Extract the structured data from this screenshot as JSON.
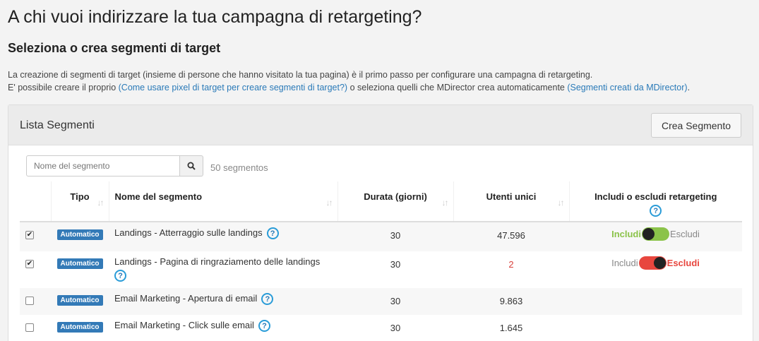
{
  "header": {
    "title": "A chi vuoi indirizzare la tua campagna di retargeting?",
    "subtitle": "Seleziona o crea segmenti di target",
    "desc_line1": "La creazione di segmenti di target (insieme di persone che hanno visitato la tua pagina) è il primo passo per configurare una campagna di retargeting.",
    "desc_line2_a": "E' possibile creare il proprio ",
    "desc_link1": "(Come usare pixel di target per creare segmenti di target?)",
    "desc_line2_b": " o seleziona quelli che MDirector crea automaticamente ",
    "desc_link2": "(Segmenti creati da MDirector)",
    "desc_line2_c": "."
  },
  "panel": {
    "title": "Lista Segmenti",
    "create_button": "Crea Segmento",
    "search_placeholder": "Nome del segmento",
    "count": "50 segmentos"
  },
  "table": {
    "columns": {
      "tipo": "Tipo",
      "nome": "Nome del segmento",
      "durata": "Durata (giorni)",
      "utenti": "Utenti unici",
      "includi": "Includi o escludi retargeting"
    },
    "rows": [
      {
        "checked": "✔",
        "tipo": "Automatico",
        "nome": "Landings - Atterraggio sulle landings",
        "durata": "30",
        "utenti": "47.596",
        "includi": "Includi",
        "escludi": "Escludi"
      },
      {
        "checked": "✔",
        "tipo": "Automatico",
        "nome": "Landings - Pagina di ringraziamento delle landings",
        "durata": "30",
        "utenti": "2",
        "includi": "Includi",
        "escludi": "Escludi"
      },
      {
        "checked": "",
        "tipo": "Automatico",
        "nome": "Email Marketing - Apertura di email",
        "durata": "30",
        "utenti": "9.863"
      },
      {
        "checked": "",
        "tipo": "Automatico",
        "nome": "Email Marketing - Click sulle email",
        "durata": "30",
        "utenti": "1.645"
      }
    ]
  },
  "colors": {
    "link": "#2a7ab8",
    "badge": "#337ab7",
    "include_green": "#8bc34a",
    "exclude_red": "#e8463e"
  }
}
